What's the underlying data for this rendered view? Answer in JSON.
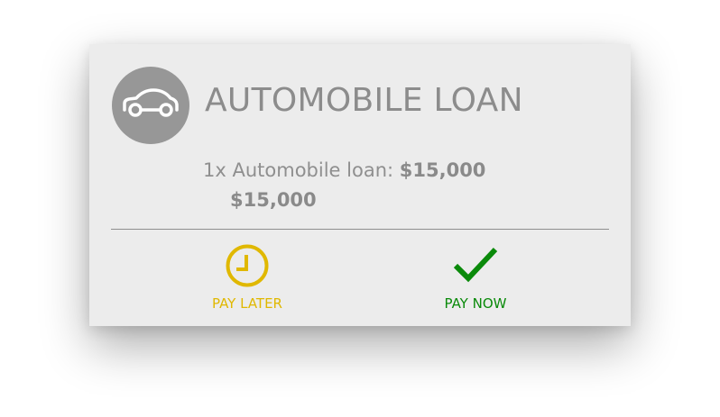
{
  "card": {
    "icon": "car-icon",
    "title": "AUTOMOBILE LOAN",
    "line_item": {
      "quantity": "1x",
      "description": "Automobile loan:",
      "amount": "$15,000"
    },
    "total": "$15,000"
  },
  "actions": {
    "pay_later": {
      "label": "PAY LATER",
      "icon": "clock-icon",
      "color": "#e0b800"
    },
    "pay_now": {
      "label": "PAY NOW",
      "icon": "checkmark-icon",
      "color": "#0a8a0a"
    }
  },
  "colors": {
    "card_background": "#ececec",
    "avatar": "#979797",
    "text": "#8c8c8c"
  }
}
